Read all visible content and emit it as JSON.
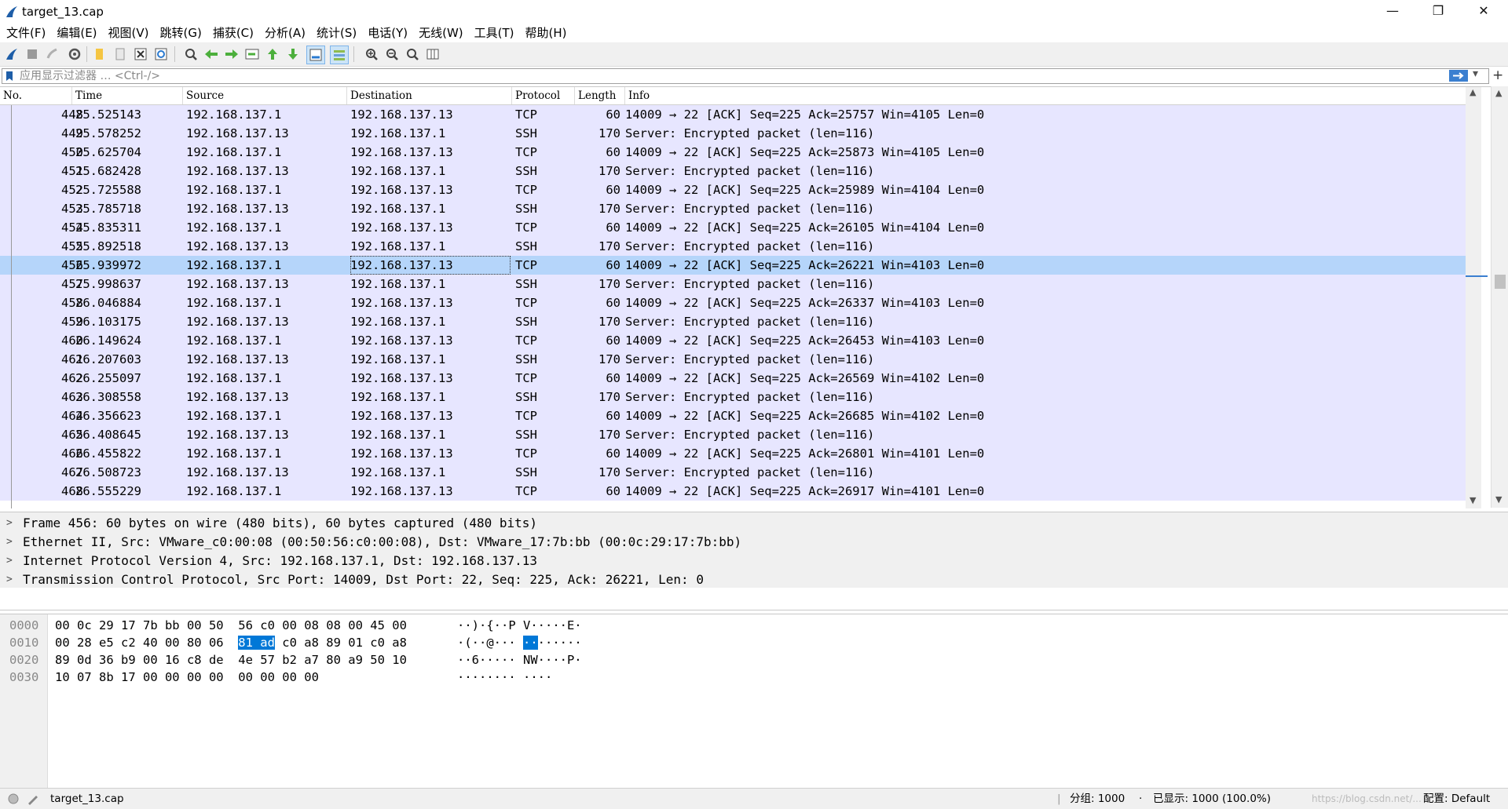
{
  "window": {
    "title": "target_13.cap",
    "minimize": "—",
    "restore": "❐",
    "close": "✕"
  },
  "menu": [
    "文件(F)",
    "编辑(E)",
    "视图(V)",
    "跳转(G)",
    "捕获(C)",
    "分析(A)",
    "统计(S)",
    "电话(Y)",
    "无线(W)",
    "工具(T)",
    "帮助(H)"
  ],
  "filter": {
    "placeholder": "应用显示过滤器 … <Ctrl-/>"
  },
  "columns": [
    "No.",
    "Time",
    "Source",
    "Destination",
    "Protocol",
    "Length",
    "Info"
  ],
  "packets": [
    {
      "no": "448",
      "time": "25.525143",
      "src": "192.168.137.1",
      "dst": "192.168.137.13",
      "proto": "TCP",
      "len": "60",
      "info": "14009 → 22 [ACK] Seq=225 Ack=25757 Win=4105 Len=0"
    },
    {
      "no": "449",
      "time": "25.578252",
      "src": "192.168.137.13",
      "dst": "192.168.137.1",
      "proto": "SSH",
      "len": "170",
      "info": "Server: Encrypted packet (len=116)"
    },
    {
      "no": "450",
      "time": "25.625704",
      "src": "192.168.137.1",
      "dst": "192.168.137.13",
      "proto": "TCP",
      "len": "60",
      "info": "14009 → 22 [ACK] Seq=225 Ack=25873 Win=4105 Len=0"
    },
    {
      "no": "451",
      "time": "25.682428",
      "src": "192.168.137.13",
      "dst": "192.168.137.1",
      "proto": "SSH",
      "len": "170",
      "info": "Server: Encrypted packet (len=116)"
    },
    {
      "no": "452",
      "time": "25.725588",
      "src": "192.168.137.1",
      "dst": "192.168.137.13",
      "proto": "TCP",
      "len": "60",
      "info": "14009 → 22 [ACK] Seq=225 Ack=25989 Win=4104 Len=0"
    },
    {
      "no": "453",
      "time": "25.785718",
      "src": "192.168.137.13",
      "dst": "192.168.137.1",
      "proto": "SSH",
      "len": "170",
      "info": "Server: Encrypted packet (len=116)"
    },
    {
      "no": "454",
      "time": "25.835311",
      "src": "192.168.137.1",
      "dst": "192.168.137.13",
      "proto": "TCP",
      "len": "60",
      "info": "14009 → 22 [ACK] Seq=225 Ack=26105 Win=4104 Len=0"
    },
    {
      "no": "455",
      "time": "25.892518",
      "src": "192.168.137.13",
      "dst": "192.168.137.1",
      "proto": "SSH",
      "len": "170",
      "info": "Server: Encrypted packet (len=116)"
    },
    {
      "no": "456",
      "time": "25.939972",
      "src": "192.168.137.1",
      "dst": "192.168.137.13",
      "proto": "TCP",
      "len": "60",
      "info": "14009 → 22 [ACK] Seq=225 Ack=26221 Win=4103 Len=0",
      "selected": true
    },
    {
      "no": "457",
      "time": "25.998637",
      "src": "192.168.137.13",
      "dst": "192.168.137.1",
      "proto": "SSH",
      "len": "170",
      "info": "Server: Encrypted packet (len=116)"
    },
    {
      "no": "458",
      "time": "26.046884",
      "src": "192.168.137.1",
      "dst": "192.168.137.13",
      "proto": "TCP",
      "len": "60",
      "info": "14009 → 22 [ACK] Seq=225 Ack=26337 Win=4103 Len=0"
    },
    {
      "no": "459",
      "time": "26.103175",
      "src": "192.168.137.13",
      "dst": "192.168.137.1",
      "proto": "SSH",
      "len": "170",
      "info": "Server: Encrypted packet (len=116)"
    },
    {
      "no": "460",
      "time": "26.149624",
      "src": "192.168.137.1",
      "dst": "192.168.137.13",
      "proto": "TCP",
      "len": "60",
      "info": "14009 → 22 [ACK] Seq=225 Ack=26453 Win=4103 Len=0"
    },
    {
      "no": "461",
      "time": "26.207603",
      "src": "192.168.137.13",
      "dst": "192.168.137.1",
      "proto": "SSH",
      "len": "170",
      "info": "Server: Encrypted packet (len=116)"
    },
    {
      "no": "462",
      "time": "26.255097",
      "src": "192.168.137.1",
      "dst": "192.168.137.13",
      "proto": "TCP",
      "len": "60",
      "info": "14009 → 22 [ACK] Seq=225 Ack=26569 Win=4102 Len=0"
    },
    {
      "no": "463",
      "time": "26.308558",
      "src": "192.168.137.13",
      "dst": "192.168.137.1",
      "proto": "SSH",
      "len": "170",
      "info": "Server: Encrypted packet (len=116)"
    },
    {
      "no": "464",
      "time": "26.356623",
      "src": "192.168.137.1",
      "dst": "192.168.137.13",
      "proto": "TCP",
      "len": "60",
      "info": "14009 → 22 [ACK] Seq=225 Ack=26685 Win=4102 Len=0"
    },
    {
      "no": "465",
      "time": "26.408645",
      "src": "192.168.137.13",
      "dst": "192.168.137.1",
      "proto": "SSH",
      "len": "170",
      "info": "Server: Encrypted packet (len=116)"
    },
    {
      "no": "466",
      "time": "26.455822",
      "src": "192.168.137.1",
      "dst": "192.168.137.13",
      "proto": "TCP",
      "len": "60",
      "info": "14009 → 22 [ACK] Seq=225 Ack=26801 Win=4101 Len=0"
    },
    {
      "no": "467",
      "time": "26.508723",
      "src": "192.168.137.13",
      "dst": "192.168.137.1",
      "proto": "SSH",
      "len": "170",
      "info": "Server: Encrypted packet (len=116)"
    },
    {
      "no": "468",
      "time": "26.555229",
      "src": "192.168.137.1",
      "dst": "192.168.137.13",
      "proto": "TCP",
      "len": "60",
      "info": "14009 → 22 [ACK] Seq=225 Ack=26917 Win=4101 Len=0"
    }
  ],
  "details": [
    "Frame 456: 60 bytes on wire (480 bits), 60 bytes captured (480 bits)",
    "Ethernet II, Src: VMware_c0:00:08 (00:50:56:c0:00:08), Dst: VMware_17:7b:bb (00:0c:29:17:7b:bb)",
    "Internet Protocol Version 4, Src: 192.168.137.1, Dst: 192.168.137.13",
    "Transmission Control Protocol, Src Port: 14009, Dst Port: 22, Seq: 225, Ack: 26221, Len: 0"
  ],
  "hex": [
    {
      "off": "0000",
      "pre": "00 0c 29 17 7b bb 00 50  56 c0 00 08 08 00 45 00",
      "hl": "",
      "post": "",
      "apre": "··)·{··P V·····E·",
      "ahl": "",
      "apost": ""
    },
    {
      "off": "0010",
      "pre": "00 28 e5 c2 40 00 80 06  ",
      "hl": "81 ad",
      "post": " c0 a8 89 01 c0 a8",
      "apre": "·(··@··· ",
      "ahl": "··",
      "apost": "······"
    },
    {
      "off": "0020",
      "pre": "89 0d 36 b9 00 16 c8 de  4e 57 b2 a7 80 a9 50 10",
      "hl": "",
      "post": "",
      "apre": "··6····· NW····P·",
      "ahl": "",
      "apost": ""
    },
    {
      "off": "0030",
      "pre": "10 07 8b 17 00 00 00 00  00 00 00 00",
      "hl": "",
      "post": "",
      "apre": "········ ····",
      "ahl": "",
      "apost": ""
    }
  ],
  "status": {
    "file": "target_13.cap",
    "packets": "分组: 1000",
    "displayed": "已显示: 1000 (100.0%)",
    "profile": "配置: Default",
    "watermark": "https://blog.csdn.net/..."
  },
  "colors": {
    "row_bg": "#e7e6ff",
    "row_selected": "#b5d5fa",
    "hex_highlight": "#0078d7"
  }
}
